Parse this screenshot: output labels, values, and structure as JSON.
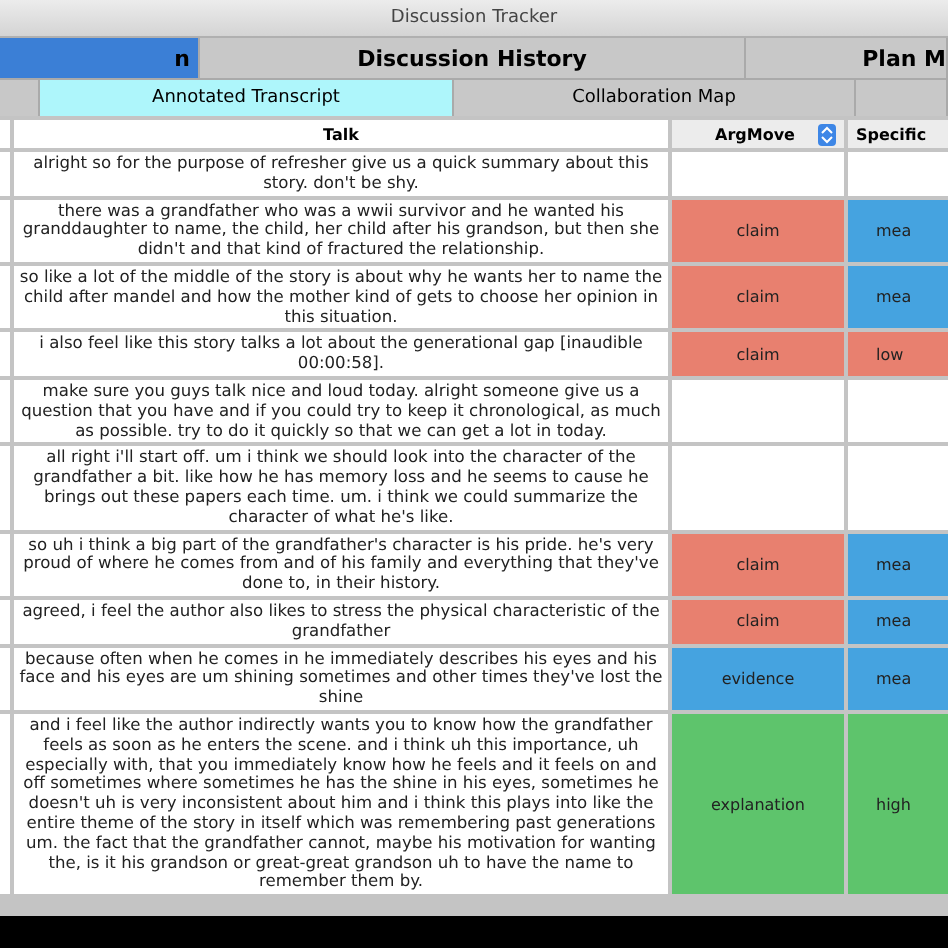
{
  "window": {
    "title": "Discussion Tracker"
  },
  "main_tabs": [
    {
      "label": "n",
      "selected": true
    },
    {
      "label": "Discussion History",
      "selected": false
    },
    {
      "label": "Plan M",
      "selected": false
    }
  ],
  "sub_tabs": [
    {
      "label": "Annotated Transcript",
      "selected": true
    },
    {
      "label": "Collaboration Map",
      "selected": false
    }
  ],
  "table": {
    "columns": [
      {
        "label": "Talk"
      },
      {
        "label": "ArgMove",
        "kind": "dropdown"
      },
      {
        "label": "Specific"
      }
    ],
    "rows": [
      {
        "talk": "alright so for the purpose of refresher give us a quick summary about this story. don't be shy."
      },
      {
        "talk": "there was a grandfather who was a wwii survivor and he wanted his granddaughter to name, the child, her child after his grandson, but then she didn't and that kind of fractured the relationship.",
        "arg_move": {
          "label": "claim",
          "color": "#e8806f"
        },
        "specificity": {
          "label": "mea",
          "color": "#45a3e0"
        }
      },
      {
        "talk": "so like a lot of the middle of the story is about why he wants her to name the child after mandel and how the mother kind of gets to choose her opinion in this situation.",
        "arg_move": {
          "label": "claim",
          "color": "#e8806f"
        },
        "specificity": {
          "label": "mea",
          "color": "#45a3e0"
        }
      },
      {
        "talk": "i also feel like this story talks a lot about the generational gap [inaudible 00:00:58].",
        "arg_move": {
          "label": "claim",
          "color": "#e8806f"
        },
        "specificity": {
          "label": "low",
          "color": "#e8806f"
        }
      },
      {
        "talk": "make sure you guys talk nice and loud today. alright someone give us a question that you have and if you could try to keep it chronological, as much as possible. try to do it quickly so that we can get a lot in today."
      },
      {
        "talk": "all right i'll start off. um i think we should look into the character of the grandfather a bit. like how he has memory loss and he seems to cause he brings out these papers each time. um. i think we could summarize the character of what he's like."
      },
      {
        "talk": "so uh i think a big part of the grandfather's character is his pride. he's very proud of where he comes from and of his family and everything that they've done to, in their history.",
        "arg_move": {
          "label": "claim",
          "color": "#e8806f"
        },
        "specificity": {
          "label": "mea",
          "color": "#45a3e0"
        }
      },
      {
        "talk": "agreed, i feel the author also likes to stress the physical characteristic of the grandfather",
        "arg_move": {
          "label": "claim",
          "color": "#e8806f"
        },
        "specificity": {
          "label": "mea",
          "color": "#45a3e0"
        }
      },
      {
        "talk": "because often when he comes in he immediately describes his eyes and his face and his eyes are um shining sometimes and other times they've lost the shine",
        "arg_move": {
          "label": "evidence",
          "color": "#45a3e0"
        },
        "specificity": {
          "label": "mea",
          "color": "#45a3e0"
        }
      },
      {
        "talk": "and i feel like the author indirectly wants you to know how the grandfather feels as soon as he enters the scene. and i think uh this importance, uh especially with, that you immediately know how he feels and it feels on and off sometimes where sometimes he has the shine in his eyes, sometimes he doesn't uh is very inconsistent about him and i think this plays into like the entire theme of the story in itself which was remembering past generations um. the fact that the grandfather cannot, maybe his motivation for wanting the, is it his grandson or great-great grandson uh to have the name to remember them by.",
        "arg_move": {
          "label": "explanation",
          "color": "#5ec46c"
        },
        "specificity": {
          "label": "high",
          "color": "#5ec46c"
        }
      }
    ]
  }
}
